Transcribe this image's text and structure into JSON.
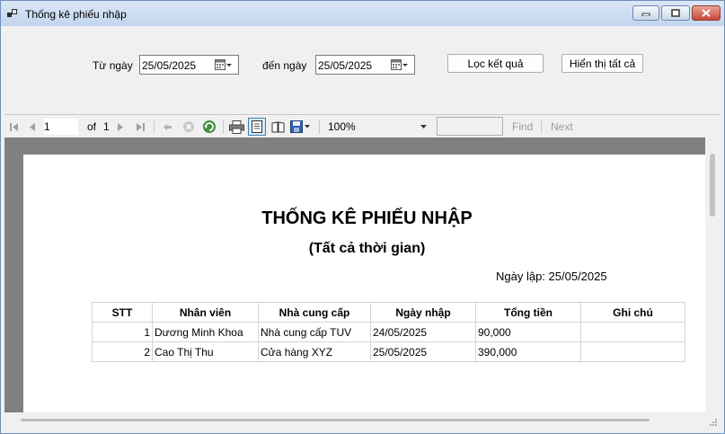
{
  "window": {
    "title": "Thống kê phiếu nhập"
  },
  "filters": {
    "from_label": "Từ ngày",
    "from_value": "25/05/2025",
    "to_label": "đến ngày",
    "to_value": "25/05/2025",
    "filter_button": "Lọc kết quả",
    "show_all_button": "Hiển thị tất cả"
  },
  "toolbar": {
    "page_current": "1",
    "page_of": "of",
    "page_total": "1",
    "zoom": "100%",
    "find_value": "",
    "find_label": "Find",
    "next_label": "Next"
  },
  "report": {
    "title": "THỐNG KÊ PHIẾU NHẬP",
    "subtitle": "(Tất cả thời gian)",
    "date_line": "Ngày lập: 25/05/2025",
    "columns": [
      "STT",
      "Nhân viên",
      "Nhà cung cấp",
      "Ngày nhập",
      "Tổng tiền",
      "Ghi chú"
    ],
    "rows": [
      [
        "1",
        "Dương Minh Khoa",
        "Nhà cung cấp TUV",
        "24/05/2025",
        "90,000",
        ""
      ],
      [
        "2",
        "Cao Thị Thu",
        "Cửa hàng XYZ",
        "25/05/2025",
        "390,000",
        ""
      ]
    ]
  },
  "icons": [
    "window-app-icon",
    "minimize-icon",
    "maximize-icon",
    "close-icon",
    "calendar-icon",
    "first-page-icon",
    "prev-page-icon",
    "next-page-icon",
    "last-page-icon",
    "back-icon",
    "stop-icon",
    "refresh-icon",
    "print-icon",
    "print-layout-icon",
    "page-setup-icon",
    "export-icon"
  ]
}
